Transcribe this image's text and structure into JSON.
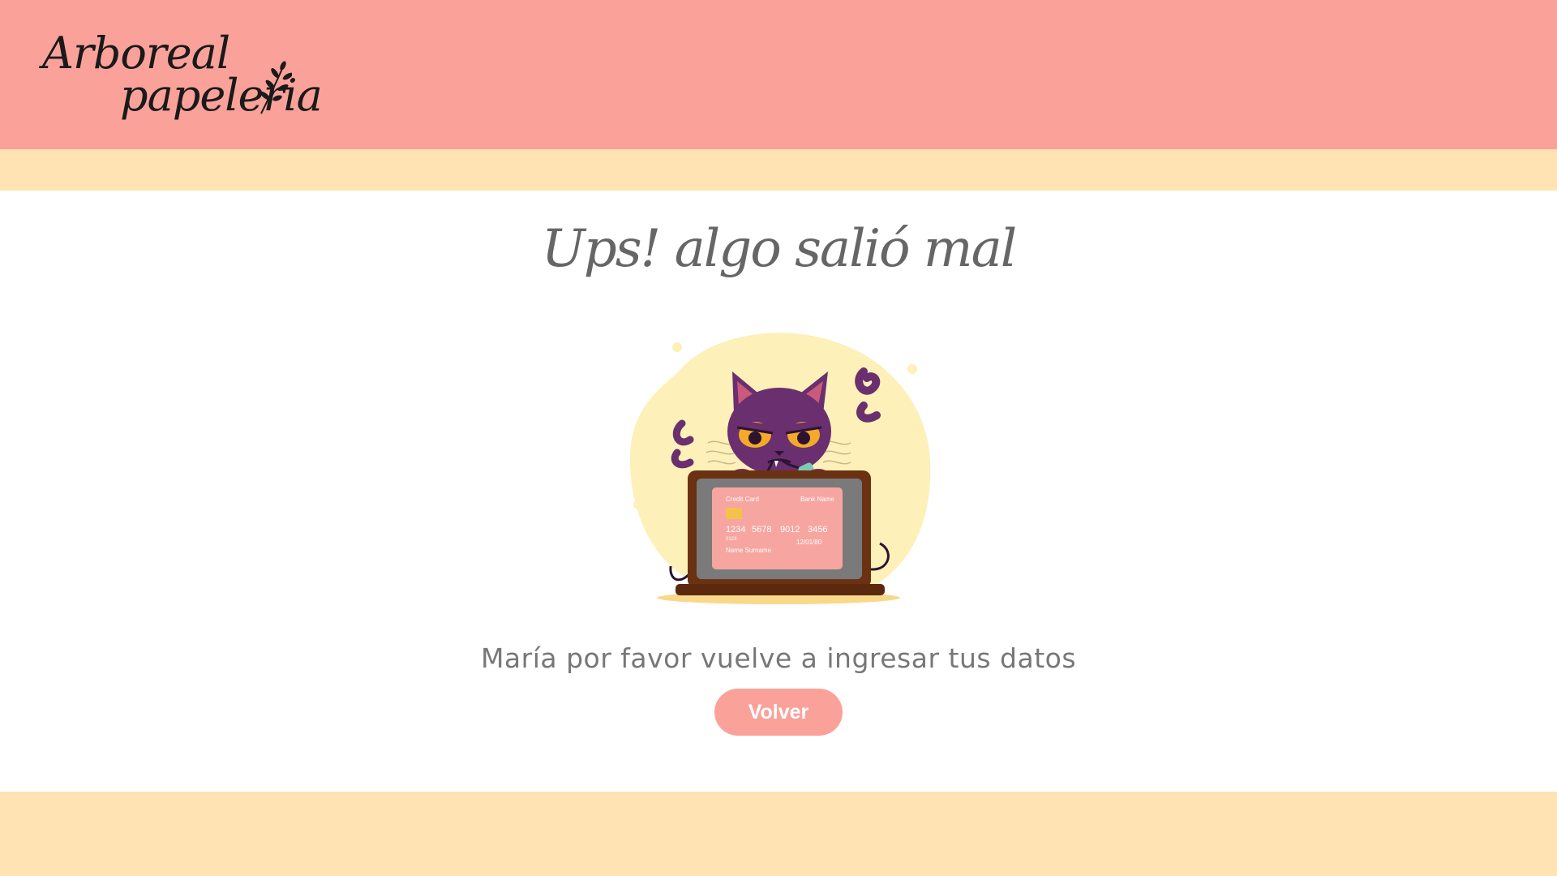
{
  "header": {
    "logo_line1": "Arboreal",
    "logo_line2": "papeleria",
    "logo_icon": "leaf-sprig-icon",
    "background_color": "#FAA29A"
  },
  "band_color": "#FFE3B2",
  "main": {
    "title": "Ups! algo salió mal",
    "illustration": {
      "icon": "angry-cat-laptop-illustration",
      "card": {
        "type_label": "Credit Card",
        "bank_label": "Bank Name",
        "number_groups": [
          "1234",
          "5678",
          "9012",
          "3456"
        ],
        "small_code": "0123",
        "expiry": "12/01/80",
        "holder": "Name Surname"
      }
    },
    "message": "María por favor vuelve a ingresar tus datos",
    "back_button_label": "Volver",
    "button_color": "#FAA29A"
  }
}
